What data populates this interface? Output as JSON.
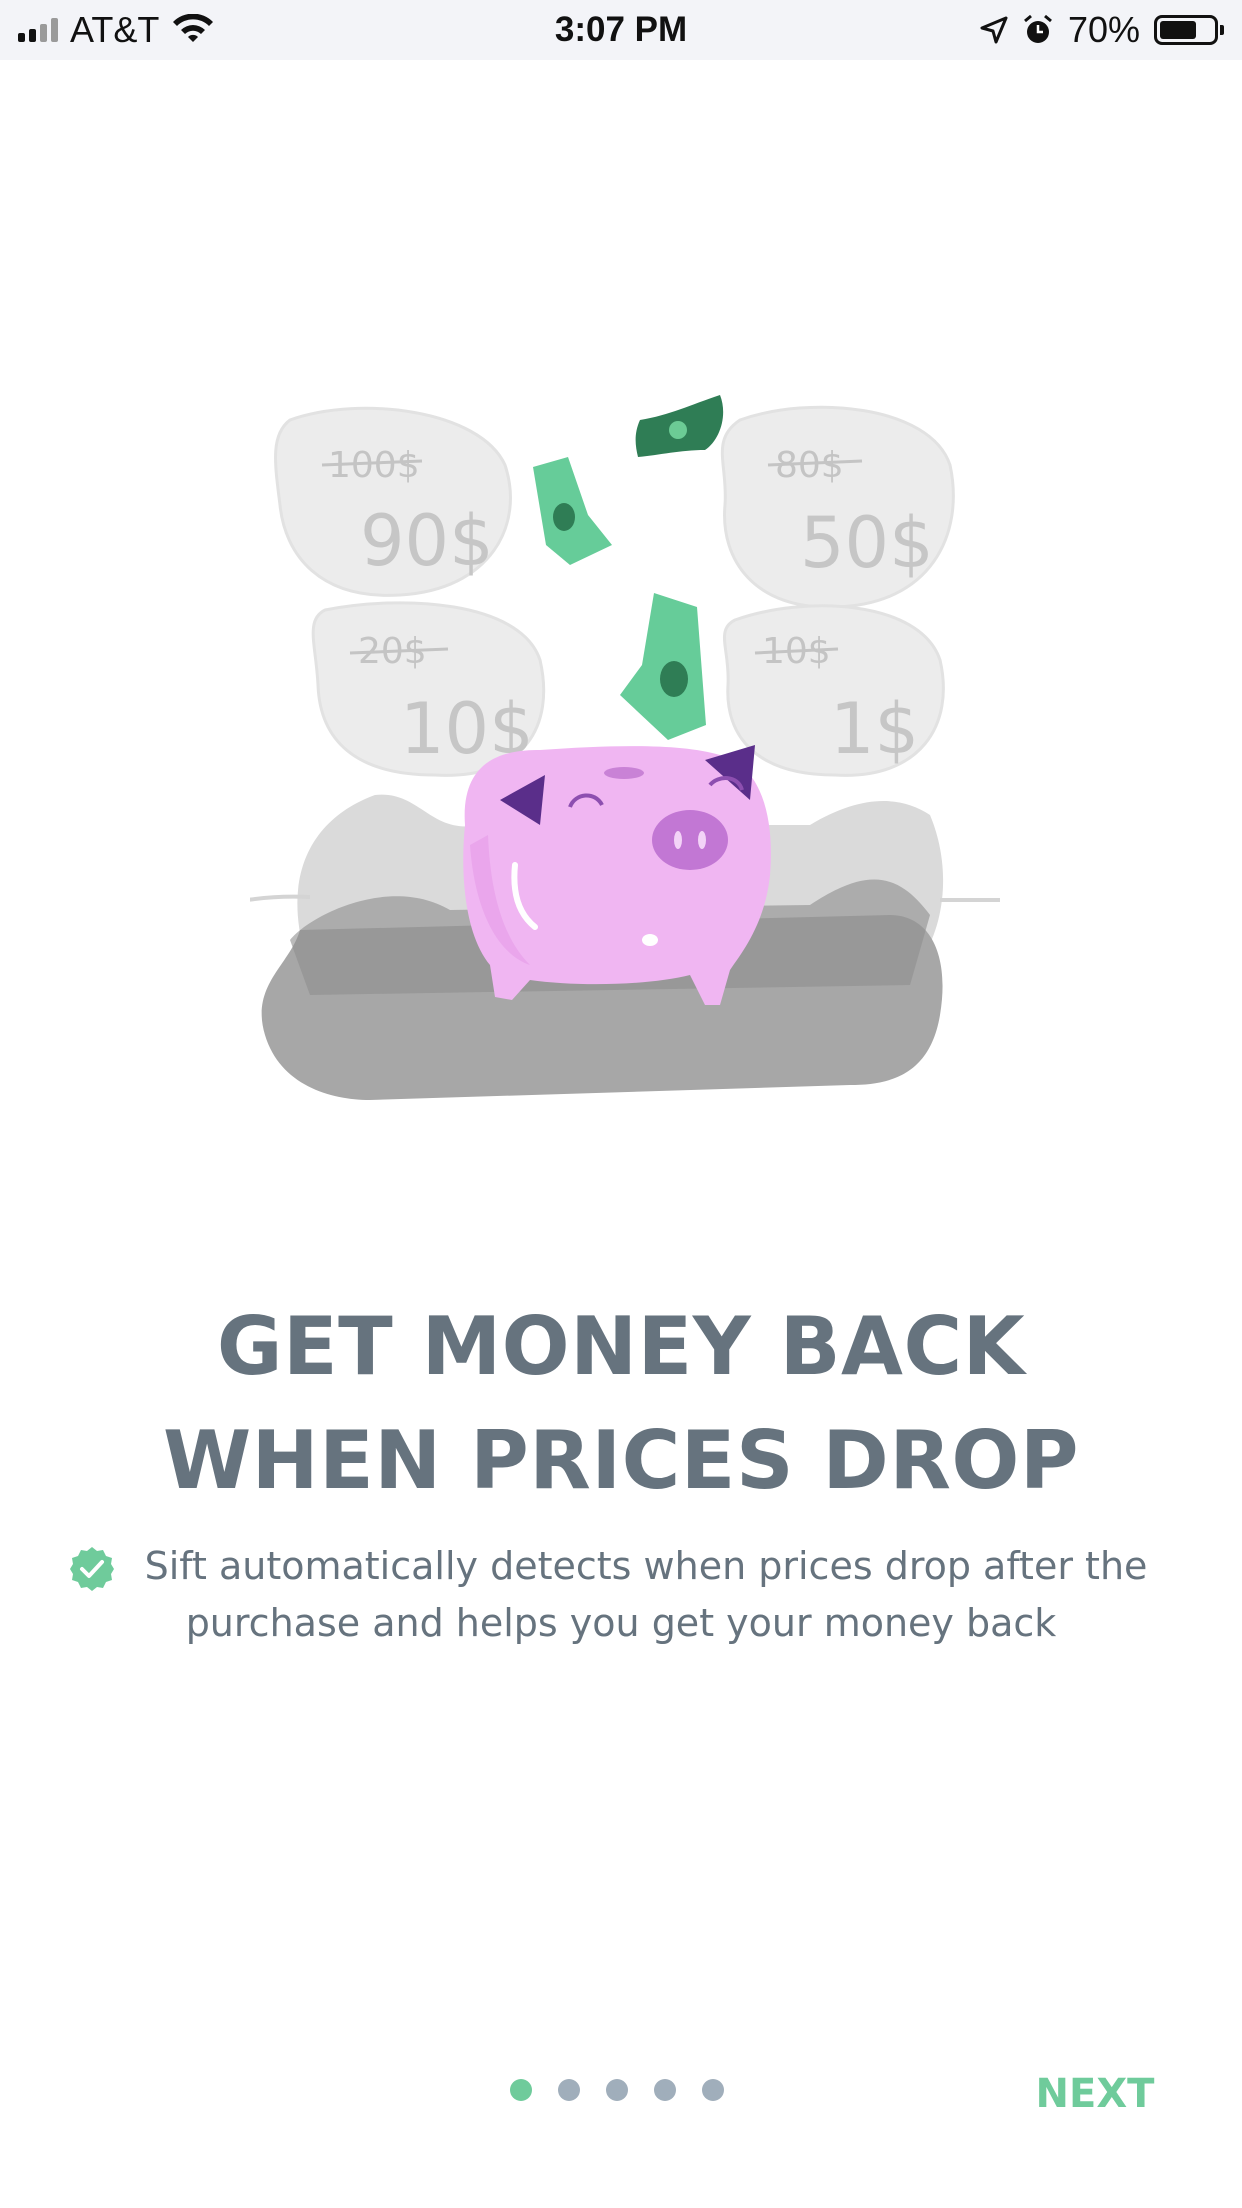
{
  "status_bar": {
    "carrier": "AT&T",
    "time": "3:07 PM",
    "battery_percent": "70%",
    "battery_level": 0.7,
    "icons": [
      "signal-icon",
      "wifi-icon",
      "location-icon",
      "alarm-icon",
      "battery-icon"
    ]
  },
  "illustration": {
    "tags": [
      {
        "old": "100$",
        "new": "90$"
      },
      {
        "old": "80$",
        "new": "50$"
      },
      {
        "old": "20$",
        "new": "10$"
      },
      {
        "old": "10$",
        "new": "1$"
      }
    ],
    "subject": "piggy-bank"
  },
  "onboarding": {
    "headline_line1": "GET MONEY BACK",
    "headline_line2": "WHEN PRICES DROP",
    "description_line1": "Sift automatically detects when prices drop after the",
    "description_line2": "purchase and helps you get your money back",
    "check_icon": "check-badge-icon"
  },
  "pagination": {
    "total": 5,
    "active_index": 0
  },
  "nav": {
    "next_label": "NEXT"
  },
  "colors": {
    "accent": "#6fcb9b",
    "text": "#66737e",
    "dot_inactive": "#a0aebb",
    "status_bar_bg": "#f3f4f8"
  }
}
